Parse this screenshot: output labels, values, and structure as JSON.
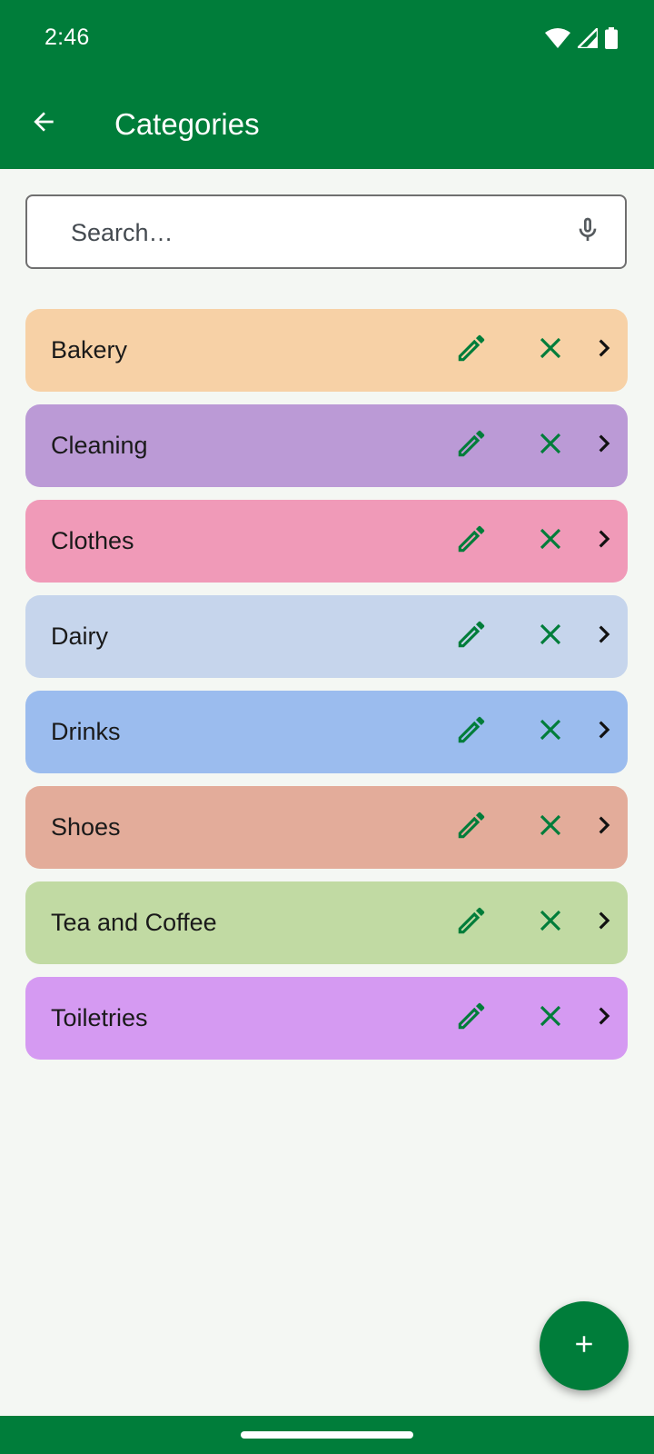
{
  "status_bar": {
    "time": "2:46",
    "icons": [
      "wifi-icon",
      "cellular-signal-icon",
      "battery-icon"
    ]
  },
  "app_bar": {
    "title": "Categories",
    "back_icon": "arrow-back-icon",
    "color": "#007D3A"
  },
  "search": {
    "placeholder": "Search…",
    "value": "",
    "mic_icon": "microphone-icon"
  },
  "categories": [
    {
      "label": "Bakery",
      "color": "#F7D1A6"
    },
    {
      "label": "Cleaning",
      "color": "#BB9AD6"
    },
    {
      "label": "Clothes",
      "color": "#F09AB8"
    },
    {
      "label": "Dairy",
      "color": "#C6D5EC"
    },
    {
      "label": "Drinks",
      "color": "#9BBCEE"
    },
    {
      "label": "Shoes",
      "color": "#E3AC9A"
    },
    {
      "label": "Tea and Coffee",
      "color": "#C1DAA3"
    },
    {
      "label": "Toiletries",
      "color": "#D59AF2"
    }
  ],
  "row_actions": {
    "edit_icon": "pencil-icon",
    "delete_icon": "close-icon",
    "open_icon": "chevron-right-icon",
    "icon_accent": "#007D3A"
  },
  "fab": {
    "icon": "plus-icon",
    "color": "#007D3A"
  }
}
